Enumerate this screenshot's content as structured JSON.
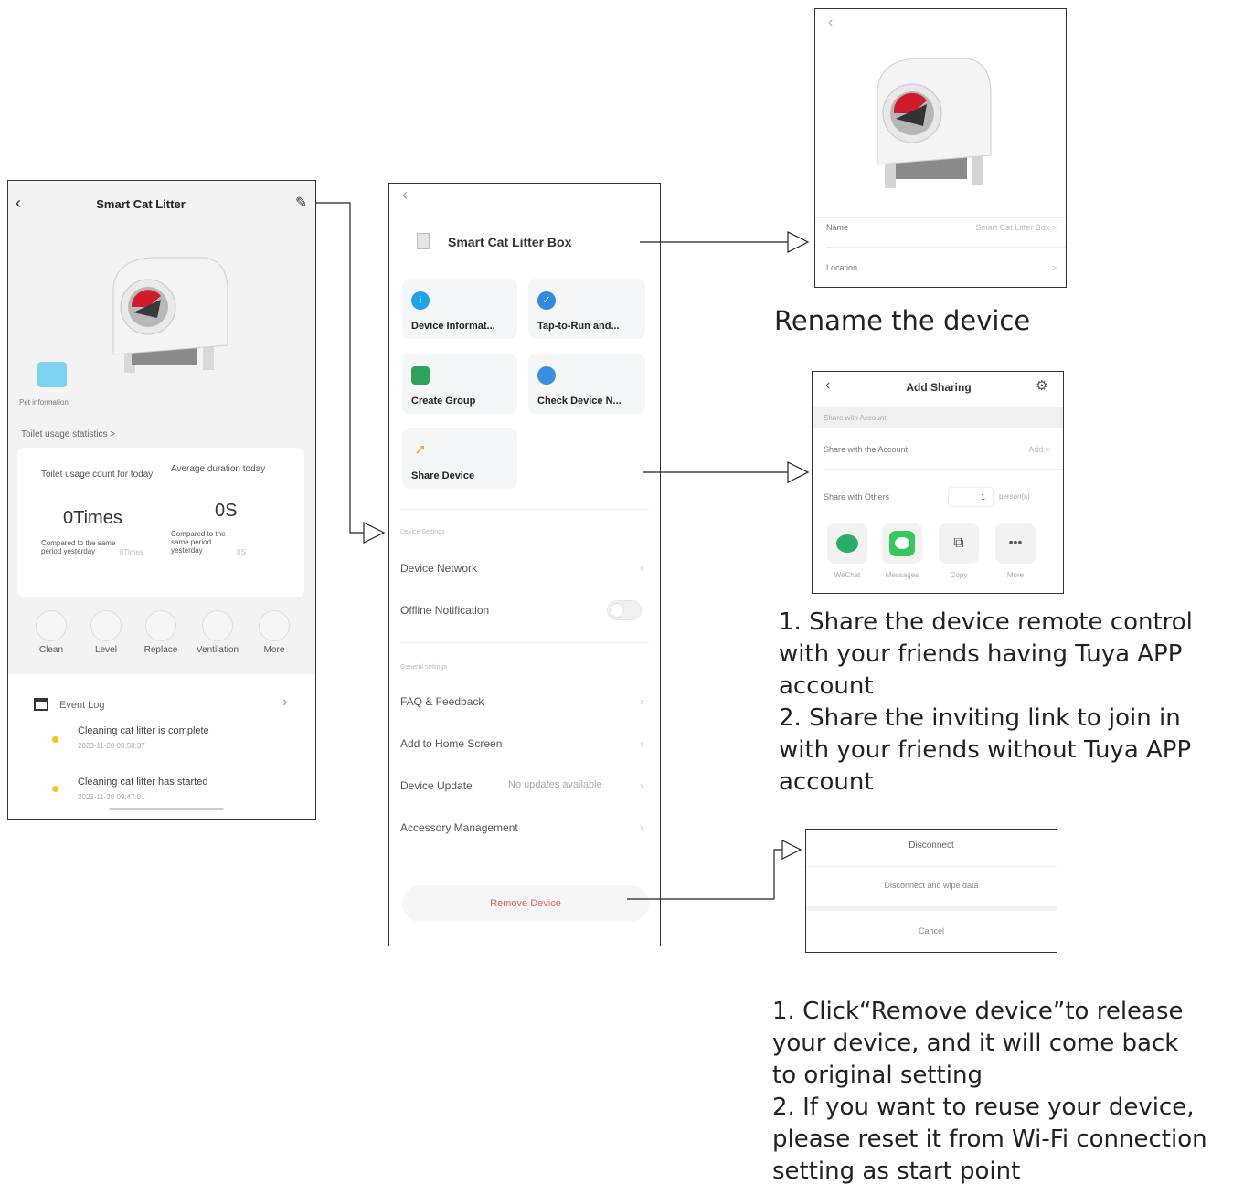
{
  "screen1": {
    "back_icon": "chevron-left-icon",
    "title": "Smart Cat Litter",
    "edit_icon": "pencil-icon",
    "pet_info_label": "Pet information",
    "toilet_stats_link": "Toilet usage statistics >",
    "usage_count_label": "Toilet usage count for today",
    "usage_count_value": "0Times",
    "usage_compare_label": "Compared to the same period yesterday",
    "usage_compare_value": "0Times",
    "avg_duration_label": "Average duration today",
    "avg_duration_value": "0S",
    "avg_compare_label": "Compared to the same period yesterday",
    "avg_compare_value": "0S",
    "actions": [
      {
        "label": "Clean",
        "icon": "clean-icon"
      },
      {
        "label": "Level",
        "icon": "level-icon"
      },
      {
        "label": "Replace",
        "icon": "replace-icon"
      },
      {
        "label": "Ventilation",
        "icon": "ventilation-icon"
      },
      {
        "label": "More",
        "icon": "more-icon"
      }
    ],
    "event_log_title": "Event Log",
    "events": [
      {
        "text": "Cleaning cat litter is complete",
        "time": "2023-11-20 09:50:37"
      },
      {
        "text": "Cleaning cat litter has started",
        "time": "2023-11-20 09:47:01"
      }
    ]
  },
  "screen2": {
    "back_icon": "chevron-left-icon",
    "device_name": "Smart Cat Litter Box",
    "grid": [
      {
        "label": "Device Informat...",
        "icon": "info-icon",
        "color": "#1fa3e8"
      },
      {
        "label": "Tap-to-Run and...",
        "icon": "check-icon",
        "color": "#2f8ae0"
      },
      {
        "label": "Create Group",
        "icon": "group-icon",
        "color": "#2fa35a"
      },
      {
        "label": "Check Device N...",
        "icon": "network-icon",
        "color": "#3b8fe0"
      },
      {
        "label": "Share Device",
        "icon": "share-icon",
        "color": "#f5a623"
      }
    ],
    "section_device": "Device Settings",
    "device_network": "Device Network",
    "offline_notification": "Offline Notification",
    "section_general": "General settings",
    "faq": "FAQ & Feedback",
    "add_home": "Add to Home Screen",
    "device_update": "Device Update",
    "device_update_value": "No updates available",
    "accessory": "Accessory Management",
    "remove_device": "Remove Device"
  },
  "screen3": {
    "back_icon": "chevron-left-icon",
    "name_label": "Name",
    "name_value": "Smart Cat Litter Box >",
    "location_label": "Location",
    "location_value": ">"
  },
  "screen4": {
    "back_icon": "chevron-left-icon",
    "title": "Add Sharing",
    "settings_icon": "gear-icon",
    "section": "Share with Account",
    "share_account": "Share with the Account",
    "share_account_action": "Add >",
    "share_others": "Share with Others",
    "share_count": "1",
    "share_unit": "person(s)",
    "apps": [
      {
        "label": "WeChat",
        "icon": "wechat-icon",
        "color": "#2aae67"
      },
      {
        "label": "Messages",
        "icon": "messages-icon",
        "color": "#34c759"
      },
      {
        "label": "Copy",
        "icon": "copy-icon",
        "color": "#555555"
      },
      {
        "label": "More",
        "icon": "more-icon",
        "color": "#555555"
      }
    ]
  },
  "screen5": {
    "disconnect": "Disconnect",
    "disconnect_wipe": "Disconnect and wipe data",
    "cancel": "Cancel"
  },
  "captions": {
    "rename": "Rename the device",
    "share": [
      "1. Share the device remote control",
      "with your friends having Tuya APP",
      "account",
      "2. Share the inviting link to join in",
      "with your friends without Tuya APP",
      "account"
    ],
    "remove": [
      "1. Click“Remove device”to release",
      "your device, and it will come back",
      "to original setting",
      "2. If you want to reuse your device,",
      "please reset it from Wi-Fi connection",
      "setting as start point"
    ]
  }
}
